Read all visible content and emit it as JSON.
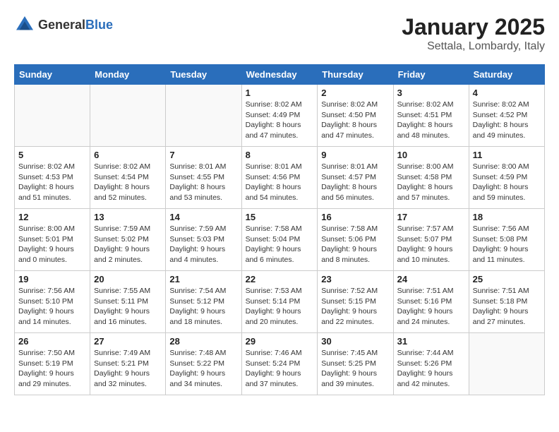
{
  "header": {
    "logo_general": "General",
    "logo_blue": "Blue",
    "month_title": "January 2025",
    "location": "Settala, Lombardy, Italy"
  },
  "days_of_week": [
    "Sunday",
    "Monday",
    "Tuesday",
    "Wednesday",
    "Thursday",
    "Friday",
    "Saturday"
  ],
  "weeks": [
    [
      {
        "date": "",
        "info": ""
      },
      {
        "date": "",
        "info": ""
      },
      {
        "date": "",
        "info": ""
      },
      {
        "date": "1",
        "info": "Sunrise: 8:02 AM\nSunset: 4:49 PM\nDaylight: 8 hours and 47 minutes."
      },
      {
        "date": "2",
        "info": "Sunrise: 8:02 AM\nSunset: 4:50 PM\nDaylight: 8 hours and 47 minutes."
      },
      {
        "date": "3",
        "info": "Sunrise: 8:02 AM\nSunset: 4:51 PM\nDaylight: 8 hours and 48 minutes."
      },
      {
        "date": "4",
        "info": "Sunrise: 8:02 AM\nSunset: 4:52 PM\nDaylight: 8 hours and 49 minutes."
      }
    ],
    [
      {
        "date": "5",
        "info": "Sunrise: 8:02 AM\nSunset: 4:53 PM\nDaylight: 8 hours and 51 minutes."
      },
      {
        "date": "6",
        "info": "Sunrise: 8:02 AM\nSunset: 4:54 PM\nDaylight: 8 hours and 52 minutes."
      },
      {
        "date": "7",
        "info": "Sunrise: 8:01 AM\nSunset: 4:55 PM\nDaylight: 8 hours and 53 minutes."
      },
      {
        "date": "8",
        "info": "Sunrise: 8:01 AM\nSunset: 4:56 PM\nDaylight: 8 hours and 54 minutes."
      },
      {
        "date": "9",
        "info": "Sunrise: 8:01 AM\nSunset: 4:57 PM\nDaylight: 8 hours and 56 minutes."
      },
      {
        "date": "10",
        "info": "Sunrise: 8:00 AM\nSunset: 4:58 PM\nDaylight: 8 hours and 57 minutes."
      },
      {
        "date": "11",
        "info": "Sunrise: 8:00 AM\nSunset: 4:59 PM\nDaylight: 8 hours and 59 minutes."
      }
    ],
    [
      {
        "date": "12",
        "info": "Sunrise: 8:00 AM\nSunset: 5:01 PM\nDaylight: 9 hours and 0 minutes."
      },
      {
        "date": "13",
        "info": "Sunrise: 7:59 AM\nSunset: 5:02 PM\nDaylight: 9 hours and 2 minutes."
      },
      {
        "date": "14",
        "info": "Sunrise: 7:59 AM\nSunset: 5:03 PM\nDaylight: 9 hours and 4 minutes."
      },
      {
        "date": "15",
        "info": "Sunrise: 7:58 AM\nSunset: 5:04 PM\nDaylight: 9 hours and 6 minutes."
      },
      {
        "date": "16",
        "info": "Sunrise: 7:58 AM\nSunset: 5:06 PM\nDaylight: 9 hours and 8 minutes."
      },
      {
        "date": "17",
        "info": "Sunrise: 7:57 AM\nSunset: 5:07 PM\nDaylight: 9 hours and 10 minutes."
      },
      {
        "date": "18",
        "info": "Sunrise: 7:56 AM\nSunset: 5:08 PM\nDaylight: 9 hours and 11 minutes."
      }
    ],
    [
      {
        "date": "19",
        "info": "Sunrise: 7:56 AM\nSunset: 5:10 PM\nDaylight: 9 hours and 14 minutes."
      },
      {
        "date": "20",
        "info": "Sunrise: 7:55 AM\nSunset: 5:11 PM\nDaylight: 9 hours and 16 minutes."
      },
      {
        "date": "21",
        "info": "Sunrise: 7:54 AM\nSunset: 5:12 PM\nDaylight: 9 hours and 18 minutes."
      },
      {
        "date": "22",
        "info": "Sunrise: 7:53 AM\nSunset: 5:14 PM\nDaylight: 9 hours and 20 minutes."
      },
      {
        "date": "23",
        "info": "Sunrise: 7:52 AM\nSunset: 5:15 PM\nDaylight: 9 hours and 22 minutes."
      },
      {
        "date": "24",
        "info": "Sunrise: 7:51 AM\nSunset: 5:16 PM\nDaylight: 9 hours and 24 minutes."
      },
      {
        "date": "25",
        "info": "Sunrise: 7:51 AM\nSunset: 5:18 PM\nDaylight: 9 hours and 27 minutes."
      }
    ],
    [
      {
        "date": "26",
        "info": "Sunrise: 7:50 AM\nSunset: 5:19 PM\nDaylight: 9 hours and 29 minutes."
      },
      {
        "date": "27",
        "info": "Sunrise: 7:49 AM\nSunset: 5:21 PM\nDaylight: 9 hours and 32 minutes."
      },
      {
        "date": "28",
        "info": "Sunrise: 7:48 AM\nSunset: 5:22 PM\nDaylight: 9 hours and 34 minutes."
      },
      {
        "date": "29",
        "info": "Sunrise: 7:46 AM\nSunset: 5:24 PM\nDaylight: 9 hours and 37 minutes."
      },
      {
        "date": "30",
        "info": "Sunrise: 7:45 AM\nSunset: 5:25 PM\nDaylight: 9 hours and 39 minutes."
      },
      {
        "date": "31",
        "info": "Sunrise: 7:44 AM\nSunset: 5:26 PM\nDaylight: 9 hours and 42 minutes."
      },
      {
        "date": "",
        "info": ""
      }
    ]
  ]
}
